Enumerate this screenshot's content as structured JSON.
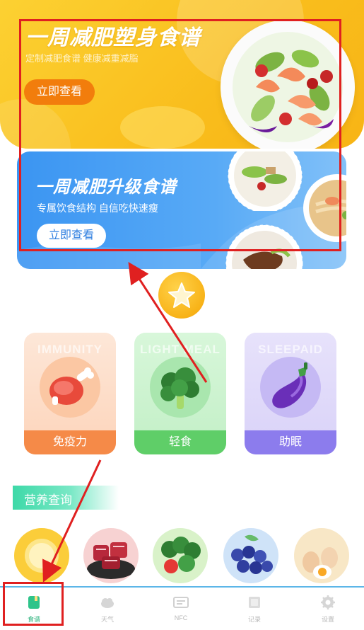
{
  "banner_top": {
    "title": "一周减肥塑身食谱",
    "subtitle": "定制减肥食谱 健康减重减脂",
    "button": "立即查看"
  },
  "banner_second": {
    "title": "一周减肥升级食谱",
    "subtitle": "专属饮食结构 自信吃快速瘦",
    "button": "立即查看"
  },
  "categories": [
    {
      "english": "IMMUNITY",
      "label": "免疫力",
      "icon": "meat-drumstick-icon"
    },
    {
      "english": "LIGHT MEAL",
      "label": "轻食",
      "icon": "broccoli-icon"
    },
    {
      "english": "SLEEPAID",
      "label": "助眠",
      "icon": "eggplant-icon"
    }
  ],
  "nutrition": {
    "heading": "营养查询",
    "foods": [
      "fruit-icon",
      "meat-icon",
      "vegetable-icon",
      "blueberry-icon",
      "egg-icon"
    ]
  },
  "tabbar": {
    "tabs": [
      {
        "label": "食谱",
        "icon": "book-icon",
        "active": true
      },
      {
        "label": "天气",
        "icon": "cloud-icon",
        "active": false
      },
      {
        "label": "NFC",
        "icon": "nfc-card-icon",
        "active": false
      },
      {
        "label": "记录",
        "icon": "note-icon",
        "active": false
      },
      {
        "label": "设置",
        "icon": "gear-icon",
        "active": false
      }
    ]
  },
  "colors": {
    "annotation": "#e02020",
    "active_tab": "#2ab27b"
  }
}
